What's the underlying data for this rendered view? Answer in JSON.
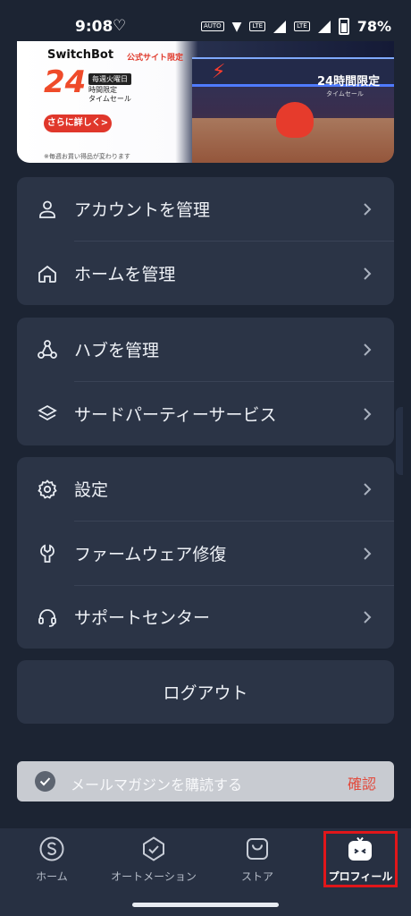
{
  "status_bar": {
    "time": "9:08",
    "heart_icon": "heart-outline-icon",
    "auto_chip": "AUTO",
    "lte_chip_1": "LTE",
    "lte_chip_2": "LTE",
    "sim_badge": "2",
    "battery": "78%"
  },
  "banner": {
    "brand": "SwitchBot",
    "tag": "公式サイト限定",
    "big_number": "24",
    "day_badge": "毎週火曜日",
    "sale_line1": "時間限定",
    "sale_line2": "タイムセール",
    "button": "さらに詳しく>",
    "note": "※毎週お買い得品が変わります",
    "store_sign": "24時間限定",
    "store_sub": "タイムセール"
  },
  "menu_groups": [
    {
      "items": [
        {
          "label": "アカウントを管理",
          "icon": "person-icon"
        },
        {
          "label": "ホームを管理",
          "icon": "house-icon"
        }
      ]
    },
    {
      "items": [
        {
          "label": "ハブを管理",
          "icon": "hub-nodes-icon"
        },
        {
          "label": "サードパーティーサービス",
          "icon": "layers-icon"
        }
      ]
    },
    {
      "items": [
        {
          "label": "設定",
          "icon": "gear-icon"
        },
        {
          "label": "ファームウェア修復",
          "icon": "wrench-icon"
        },
        {
          "label": "サポートセンター",
          "icon": "headset-icon"
        }
      ]
    }
  ],
  "logout": "ログアウト",
  "newsletter": {
    "label": "メールマガジンを購読する",
    "confirm": "確認"
  },
  "tabs": [
    {
      "label": "ホーム",
      "icon": "switchbot-s-icon",
      "active": false
    },
    {
      "label": "オートメーション",
      "icon": "shield-check-icon",
      "active": false
    },
    {
      "label": "ストア",
      "icon": "shopping-bag-icon",
      "active": false
    },
    {
      "label": "プロフィール",
      "icon": "robot-face-icon",
      "active": true
    }
  ],
  "colors": {
    "background": "#1c2433",
    "card": "#2b3446",
    "accent_red": "#e24a3c",
    "highlight_box": "#e1161a"
  }
}
